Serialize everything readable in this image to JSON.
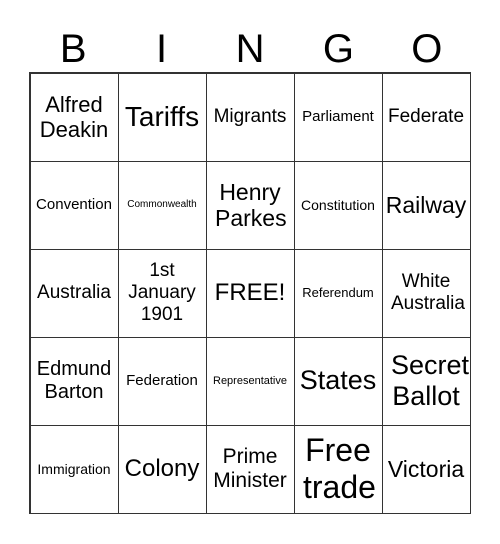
{
  "header": [
    "B",
    "I",
    "N",
    "G",
    "O"
  ],
  "cells": [
    "Alfred Deakin",
    "Tariffs",
    "Migrants",
    "Parliament",
    "Federate",
    "Convention",
    "Commonwealth",
    "Henry Parkes",
    "Constitution",
    "Railway",
    "Australia",
    "1st January 1901",
    "FREE!",
    "Referendum",
    "White Australia",
    "Edmund Barton",
    "Federation",
    "Representative",
    "States",
    "Secret Ballot",
    "Immigration",
    "Colony",
    "Prime Minister",
    "Free trade",
    "Victoria"
  ]
}
